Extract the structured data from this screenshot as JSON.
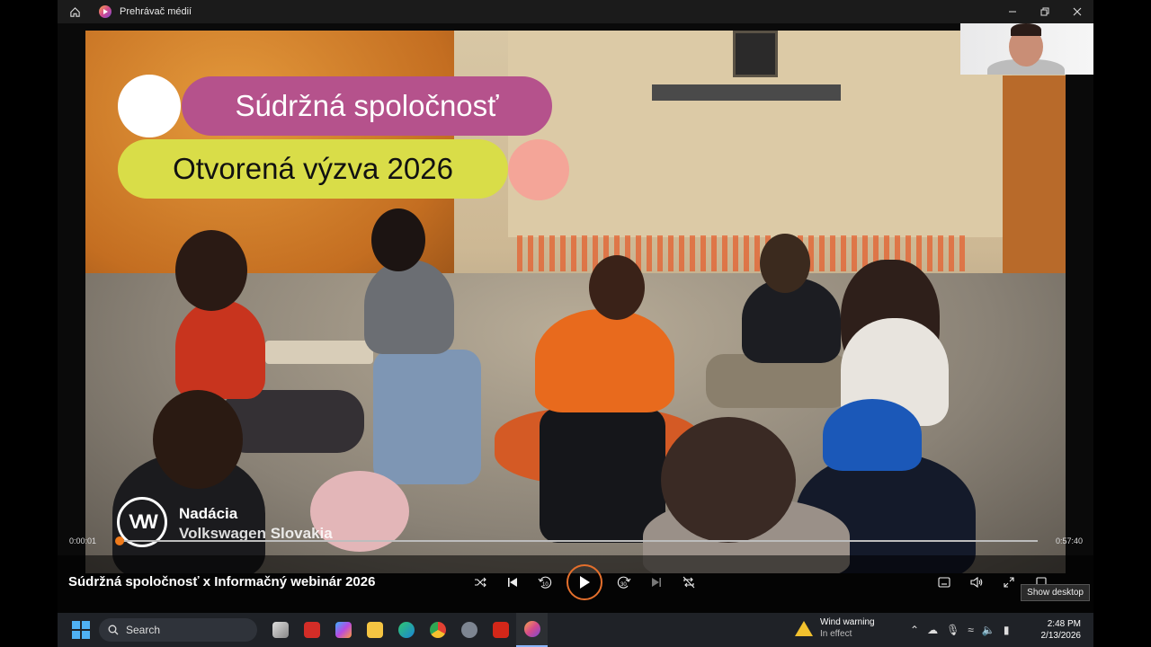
{
  "window": {
    "title": "Prehrávač médií"
  },
  "video": {
    "overlay_line1": "Súdržná spoločnosť",
    "overlay_line2": "Otvorená výzva 2026",
    "logo_text_line1": "Nadácia",
    "logo_text_line2": "Volkswagen Slovakia",
    "logo_mark": "VW"
  },
  "player": {
    "media_title": "Súdržná spoločnosť x Informačný webinár 2026",
    "elapsed": "0:00:01",
    "duration": "0:57:40",
    "progress_fraction": 0.001,
    "tooltip": "Show desktop",
    "skip_back_seconds": "10",
    "skip_forward_seconds": "30"
  },
  "taskbar": {
    "search_placeholder": "Search",
    "weather_title": "Wind warning",
    "weather_status": "In effect",
    "time": "2:48 PM",
    "date": "2/13/2026",
    "apps": [
      "task-view",
      "lastpass",
      "copilot",
      "file-explorer",
      "edge",
      "chrome",
      "settings",
      "acrobat",
      "media-player"
    ]
  },
  "colors": {
    "purple_pill": "#b5528c",
    "yellow_pill": "#d9dd48",
    "accent_orange": "#f07a1a",
    "taskbar_bg": "#1f2227"
  }
}
